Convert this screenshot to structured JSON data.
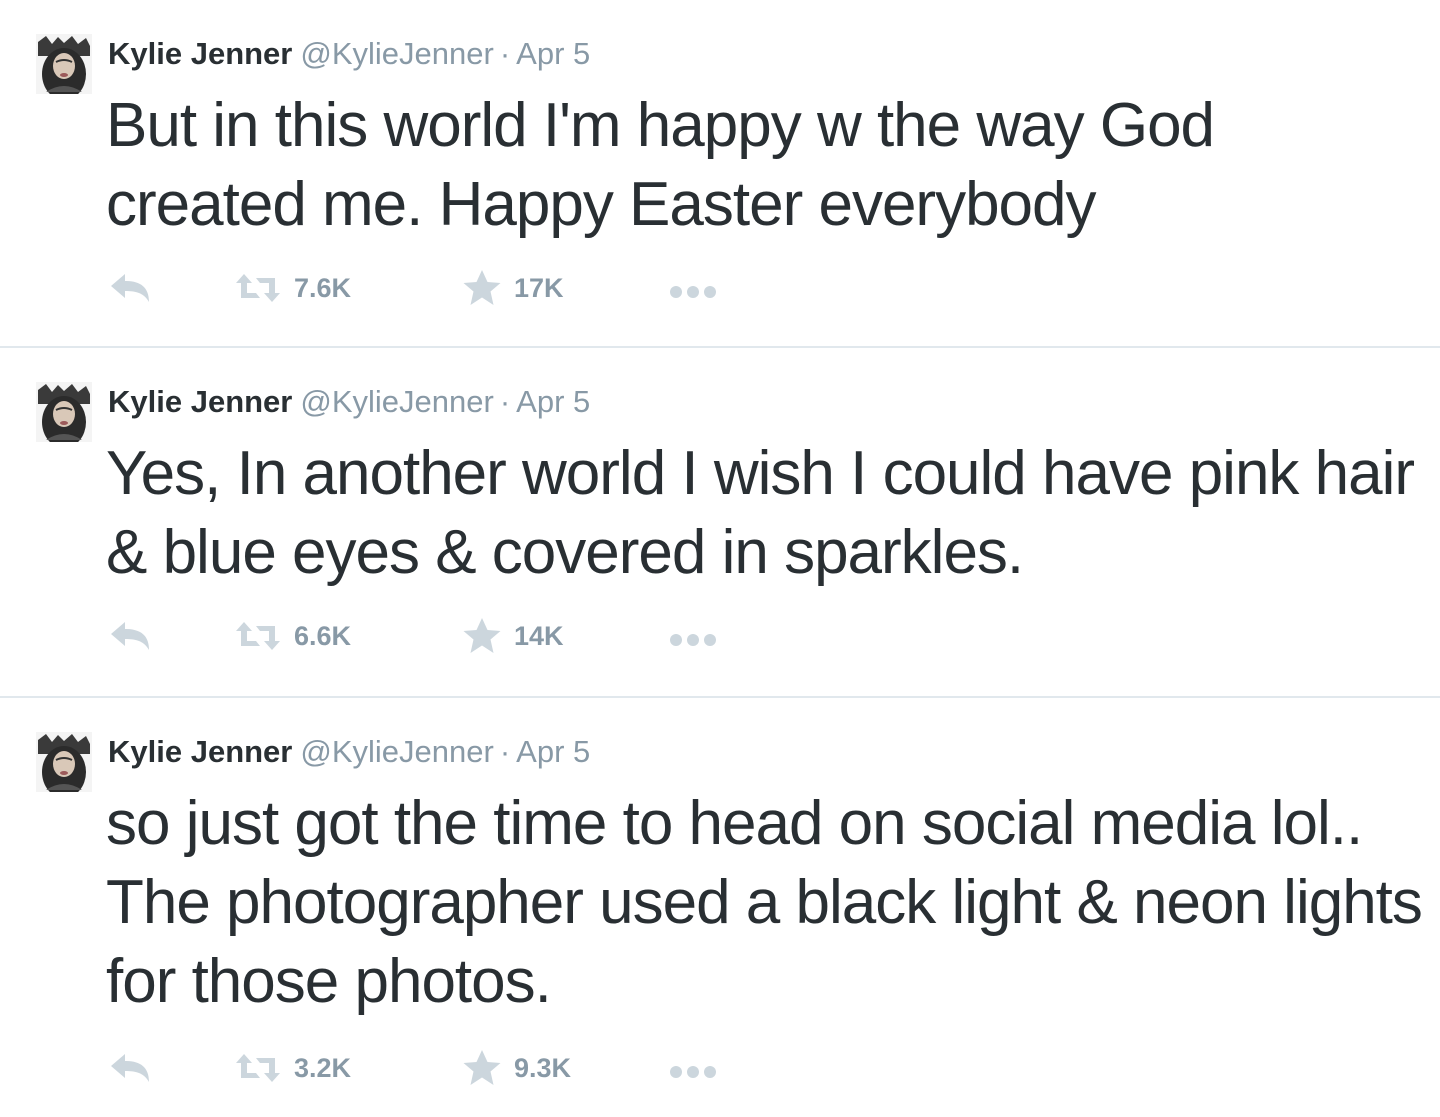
{
  "tweets": [
    {
      "name": "Kylie Jenner",
      "handle": "@KylieJenner",
      "separator": "·",
      "date": "Apr 5",
      "text": "But in this world I'm happy w the way God created me. Happy Easter everybody",
      "retweets": "7.6K",
      "favorites": "17K"
    },
    {
      "name": "Kylie Jenner",
      "handle": "@KylieJenner",
      "separator": "·",
      "date": "Apr 5",
      "text": "Yes, In another world I wish I could have pink hair & blue eyes & covered in sparkles.",
      "retweets": "6.6K",
      "favorites": "14K"
    },
    {
      "name": "Kylie Jenner",
      "handle": "@KylieJenner",
      "separator": "·",
      "date": "Apr 5",
      "text": "so just got the time to head on social media lol.. The photographer used a black light & neon lights for those photos.",
      "retweets": "3.2K",
      "favorites": "9.3K"
    }
  ],
  "icons": {
    "reply": "reply-icon",
    "retweet": "retweet-icon",
    "favorite": "star-icon",
    "more": "more-icon"
  },
  "colors": {
    "text": "#292f33",
    "muted": "#8899a6",
    "icon": "#ccd6dd",
    "divider": "#e1e8ed"
  }
}
